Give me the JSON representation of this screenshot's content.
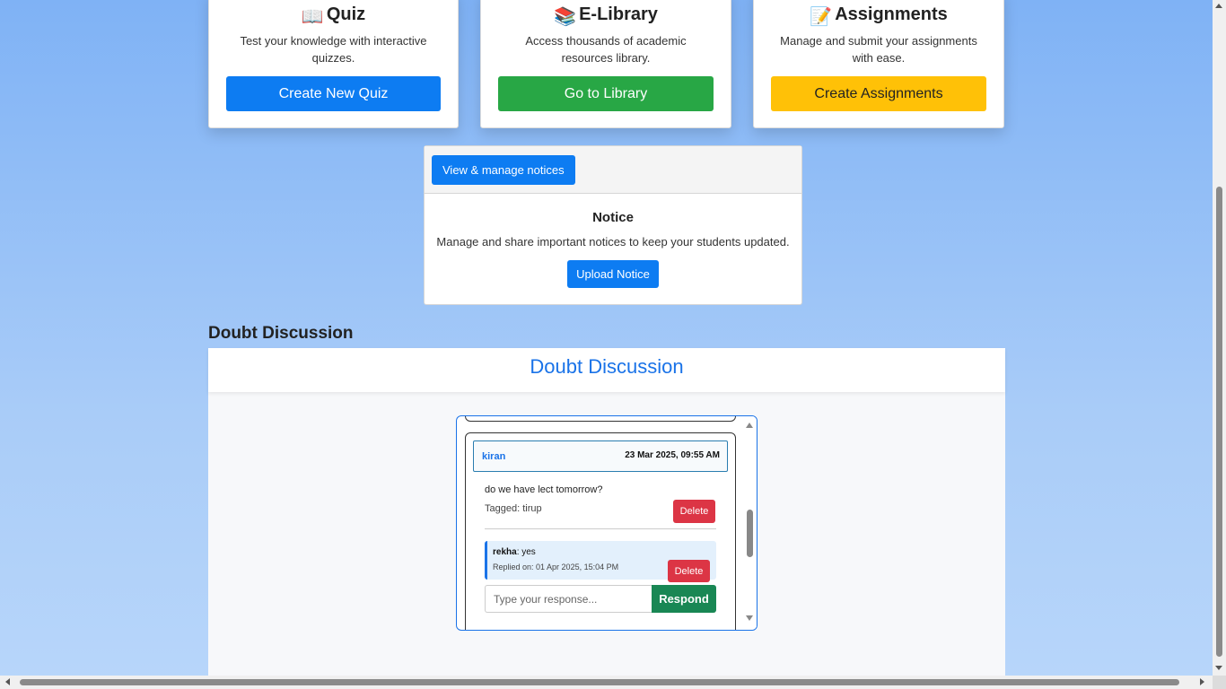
{
  "cards": [
    {
      "icon": "open-book-icon",
      "glyph": "📖",
      "title": "Quiz",
      "desc": "Test your knowledge with interactive quizzes.",
      "button": "Create New Quiz"
    },
    {
      "icon": "books-stack-icon",
      "glyph": "📚",
      "title": "E-Library",
      "desc": "Access thousands of academic resources library.",
      "button": "Go to Library"
    },
    {
      "icon": "memo-icon",
      "glyph": "📝",
      "title": "Assignments",
      "desc": "Manage and submit your assignments with ease.",
      "button": "Create Assignments"
    }
  ],
  "notice": {
    "header_button": "View & manage notices",
    "title": "Notice",
    "desc": "Manage and share important notices to keep your students updated.",
    "upload_button": "Upload Notice"
  },
  "doubt": {
    "section_heading": "Doubt Discussion",
    "banner_title": "Doubt Discussion",
    "post": {
      "author": "kiran",
      "timestamp": "23 Mar 2025, 09:55 AM",
      "text": "do we have lect tomorrow?",
      "tag": "Tagged: tirup",
      "delete_label": "Delete",
      "reply": {
        "author": "rekha",
        "text": ": yes",
        "meta": "Replied on: 01 Apr 2025, 15:04 PM",
        "delete_label": "Delete"
      },
      "response_placeholder": "Type your response...",
      "respond_label": "Respond"
    }
  },
  "colors": {
    "primary": "#0d7cf2",
    "success": "#28a745",
    "warning": "#ffc107",
    "danger": "#dc3545",
    "respond": "#198754"
  }
}
